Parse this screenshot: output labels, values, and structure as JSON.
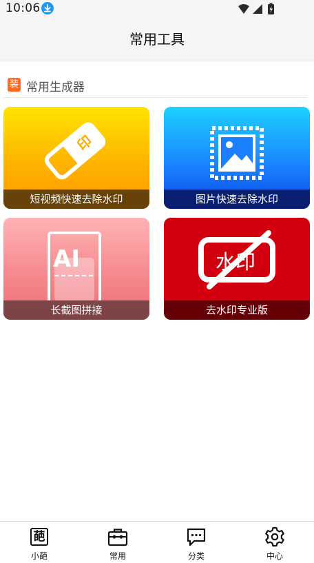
{
  "status_bar": {
    "time": "10:06"
  },
  "header": {
    "title": "常用工具"
  },
  "section": {
    "badge": "装",
    "title": "常用生成器"
  },
  "tools": [
    {
      "label": "短视频快速去除水印",
      "icon": "eraser-icon",
      "art_text": "印"
    },
    {
      "label": "图片快速去除水印",
      "icon": "image-stamp-icon"
    },
    {
      "label": "长截图拼接",
      "icon": "long-screenshot-icon",
      "art_text": "AI"
    },
    {
      "label": "去水印专业版",
      "icon": "no-watermark-icon",
      "art_text": "水印"
    }
  ],
  "bottom_nav": [
    {
      "label": "小葩",
      "icon": "pa-char-icon",
      "icon_text": "葩"
    },
    {
      "label": "常用",
      "icon": "toolbox-icon"
    },
    {
      "label": "分类",
      "icon": "chat-bubble-icon"
    },
    {
      "label": "中心",
      "icon": "gear-icon"
    }
  ],
  "colors": {
    "accent_orange": "#ff6a1f",
    "tile_yellow": "#ffc400",
    "tile_blue": "#1a86ff",
    "tile_pink": "#f5868c",
    "tile_red": "#d2000e"
  }
}
